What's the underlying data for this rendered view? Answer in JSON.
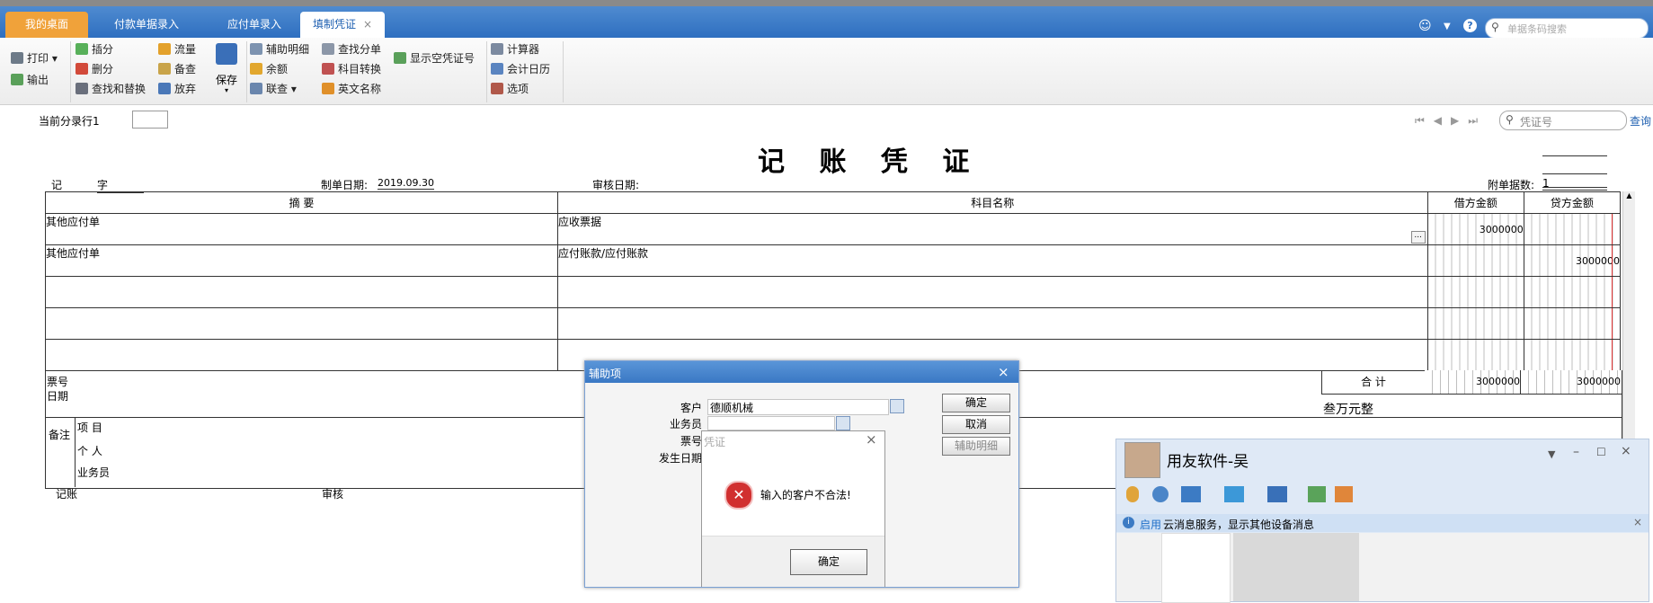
{
  "tabs": {
    "home": "我的桌面",
    "payment_entry": "付款单据录入",
    "payable_entry": "应付单录入",
    "voucher": "填制凭证",
    "close_mark": "×"
  },
  "top_search": {
    "placeholder": "单据条码搜索"
  },
  "toolbar": {
    "print": "打印",
    "export": "输出",
    "insert": "插分",
    "delete": "删分",
    "find_replace": "查找和替换",
    "flow": "流量",
    "memo": "备查",
    "discard": "放弃",
    "save": "保存",
    "aux_detail": "辅助明细",
    "balance": "余额",
    "linked_query": "联查",
    "find_entry": "查找分单",
    "account_convert": "科目转换",
    "english_name": "英文名称",
    "show_empty_no": "显示空凭证号",
    "calculator": "计算器",
    "accounting_calendar": "会计日历",
    "options": "选项"
  },
  "nav": {
    "current_row_label": "当前分录行1",
    "search_placeholder": "凭证号",
    "query": "查询"
  },
  "voucher": {
    "title": "记 账 凭 证",
    "type_label": "记",
    "char_label": "字",
    "date_label": "制单日期:",
    "date_value": "2019.09.30",
    "audit_date_label": "审核日期:",
    "attach_label": "附单据数:",
    "attach_value": "1",
    "headers": {
      "summary": "摘 要",
      "account": "科目名称",
      "debit": "借方金额",
      "credit": "贷方金额"
    },
    "rows": [
      {
        "summary": "其他应付单",
        "account": "应收票据",
        "debit": "3000000",
        "credit": ""
      },
      {
        "summary": "其他应付单",
        "account": "应付账款/应付账款",
        "debit": "",
        "credit": "3000000"
      },
      {
        "summary": "",
        "account": "",
        "debit": "",
        "credit": ""
      },
      {
        "summary": "",
        "account": "",
        "debit": "",
        "credit": ""
      },
      {
        "summary": "",
        "account": "",
        "debit": "",
        "credit": ""
      }
    ],
    "ticket_no_label": "票号",
    "date2_label": "日期",
    "total_label": "合 计",
    "total_debit": "3000000",
    "total_credit": "3000000",
    "total_words": "叁万元整",
    "remark_label": "备注",
    "project_label": "项 目",
    "person_label": "个 人",
    "salesman_label": "业务员",
    "bookkeep_label": "记账",
    "review_label": "审核",
    "ellipsis": "..."
  },
  "aux_dialog": {
    "title": "辅助项",
    "close": "×",
    "customer_label": "客户",
    "customer_value": "德顺机械",
    "salesman_label": "业务员",
    "ticket_label": "票号",
    "occur_date_label": "发生日期",
    "ok": "确定",
    "cancel": "取消",
    "aux_detail": "辅助明细"
  },
  "error_dialog": {
    "title": "凭证",
    "close": "×",
    "message": "输入的客户不合法!",
    "ok": "确定"
  },
  "chat": {
    "title": "用友软件-吴",
    "notice_prefix": "启用",
    "notice": "云消息服务，显示其他设备消息",
    "close": "×"
  }
}
